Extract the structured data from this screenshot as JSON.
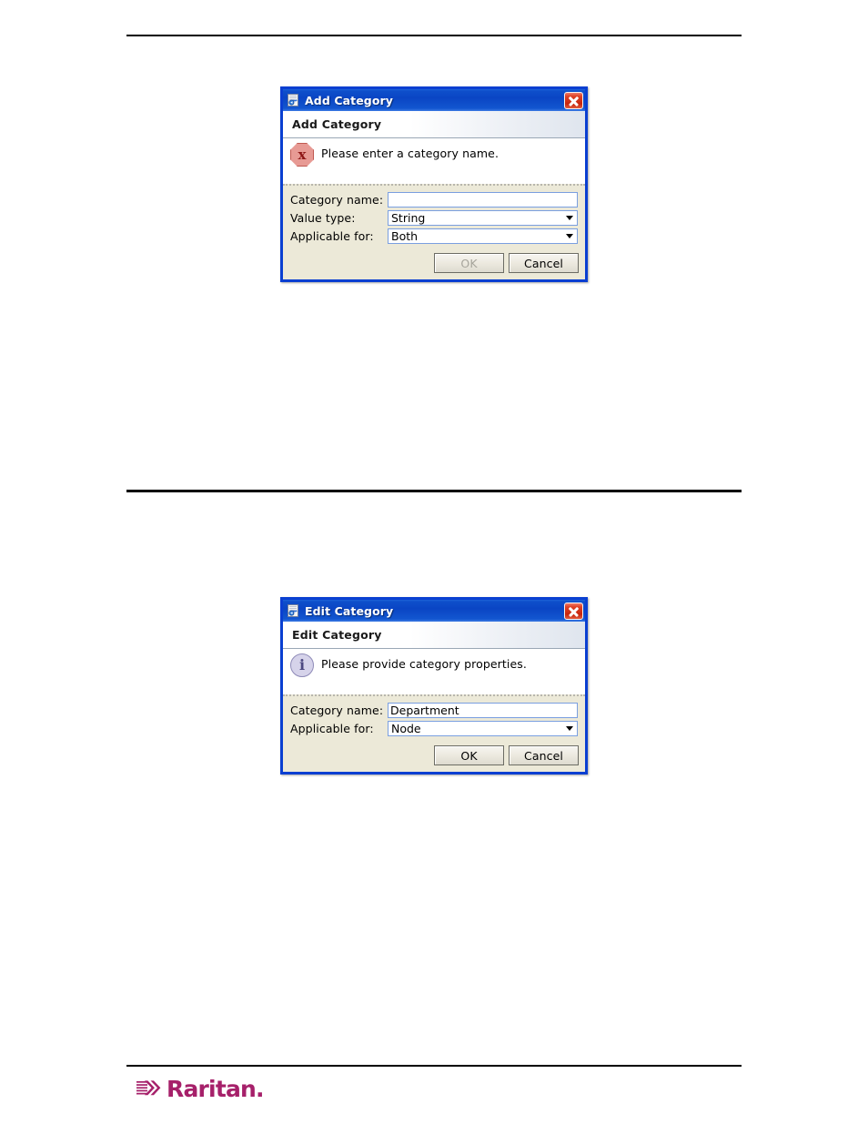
{
  "page": {
    "footer_logo_text": "Raritan.",
    "brand_color": "#a6206a"
  },
  "dialogs": [
    {
      "id": "add-category",
      "titlebar": {
        "icon": "java-app-icon",
        "title": "Add Category",
        "close_label": "close-icon"
      },
      "banner_title": "Add Category",
      "message": {
        "icon": "error-icon",
        "glyph": "x",
        "text": "Please enter a category name."
      },
      "fields": [
        {
          "label": "Category name:",
          "type": "text",
          "value": "",
          "placeholder": ""
        },
        {
          "label": "Value type:",
          "type": "combo",
          "value": "String"
        },
        {
          "label": "Applicable for:",
          "type": "combo",
          "value": "Both"
        }
      ],
      "buttons": [
        {
          "label": "OK",
          "enabled": false
        },
        {
          "label": "Cancel",
          "enabled": true
        }
      ]
    },
    {
      "id": "edit-category",
      "titlebar": {
        "icon": "java-app-icon",
        "title": "Edit Category",
        "close_label": "close-icon"
      },
      "banner_title": "Edit Category",
      "message": {
        "icon": "info-icon",
        "glyph": "i",
        "text": "Please provide category properties."
      },
      "fields": [
        {
          "label": "Category name:",
          "type": "text",
          "value": "Department",
          "placeholder": ""
        },
        {
          "label": "Applicable for:",
          "type": "combo",
          "value": "Node"
        }
      ],
      "buttons": [
        {
          "label": "OK",
          "enabled": true
        },
        {
          "label": "Cancel",
          "enabled": true
        }
      ]
    }
  ]
}
